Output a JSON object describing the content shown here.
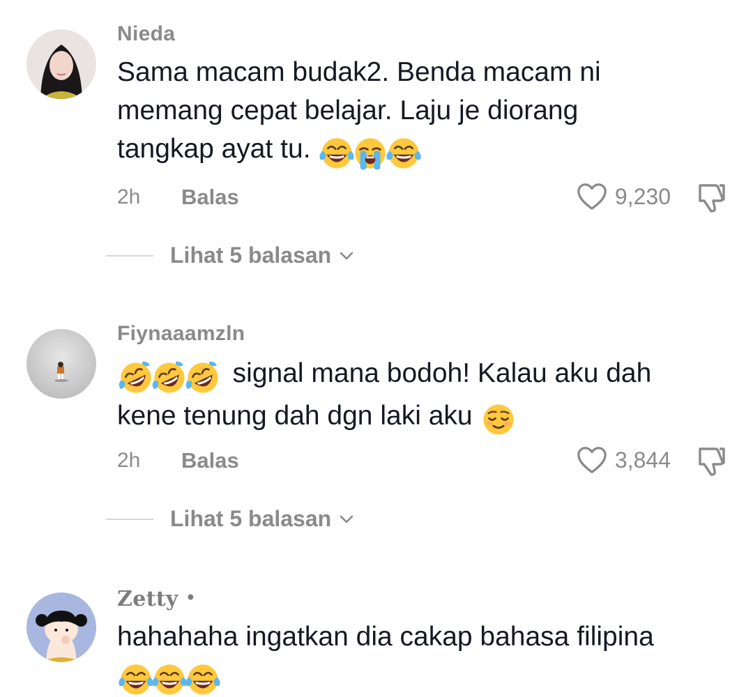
{
  "comments": [
    {
      "username": "Nieda",
      "lines": [
        "Sama macam budak2. Benda macam ni",
        "memang cepat belajar. Laju je diorang",
        "tangkap ayat tu."
      ],
      "emojis": [
        "face-with-tears-of-joy",
        "loudly-crying-face",
        "face-with-tears-of-joy"
      ],
      "time": "2h",
      "reply_label": "Balas",
      "likes": "9,230",
      "view_replies": "Lihat 5 balasan"
    },
    {
      "username": "Fiynaaamzln",
      "lines": [
        "signal mana bodoh! Kalau aku dah",
        "kene tenung dah dgn laki aku"
      ],
      "emojis_leading": [
        "rolling-on-floor-laughing",
        "rolling-on-floor-laughing",
        "rolling-on-floor-laughing"
      ],
      "emojis_trailing": [
        "relieved-face"
      ],
      "time": "2h",
      "reply_label": "Balas",
      "likes": "3,844",
      "view_replies": "Lihat 5 balasan"
    },
    {
      "username": "Zetty",
      "username_suffix": "•",
      "lines": [
        "hahahaha ingatkan dia cakap bahasa filipina"
      ],
      "emojis": [
        "face-with-tears-of-joy",
        "face-with-tears-of-joy",
        "face-with-tears-of-joy"
      ]
    }
  ],
  "icons": {
    "like": "heart-outline-icon",
    "dislike": "thumbs-down-outline-icon",
    "expand": "chevron-down-icon"
  },
  "colors": {
    "text": "#161823",
    "muted": "#8a8a8a",
    "emoji_face": "#ffc83d",
    "tears": "#5ab7f0"
  }
}
